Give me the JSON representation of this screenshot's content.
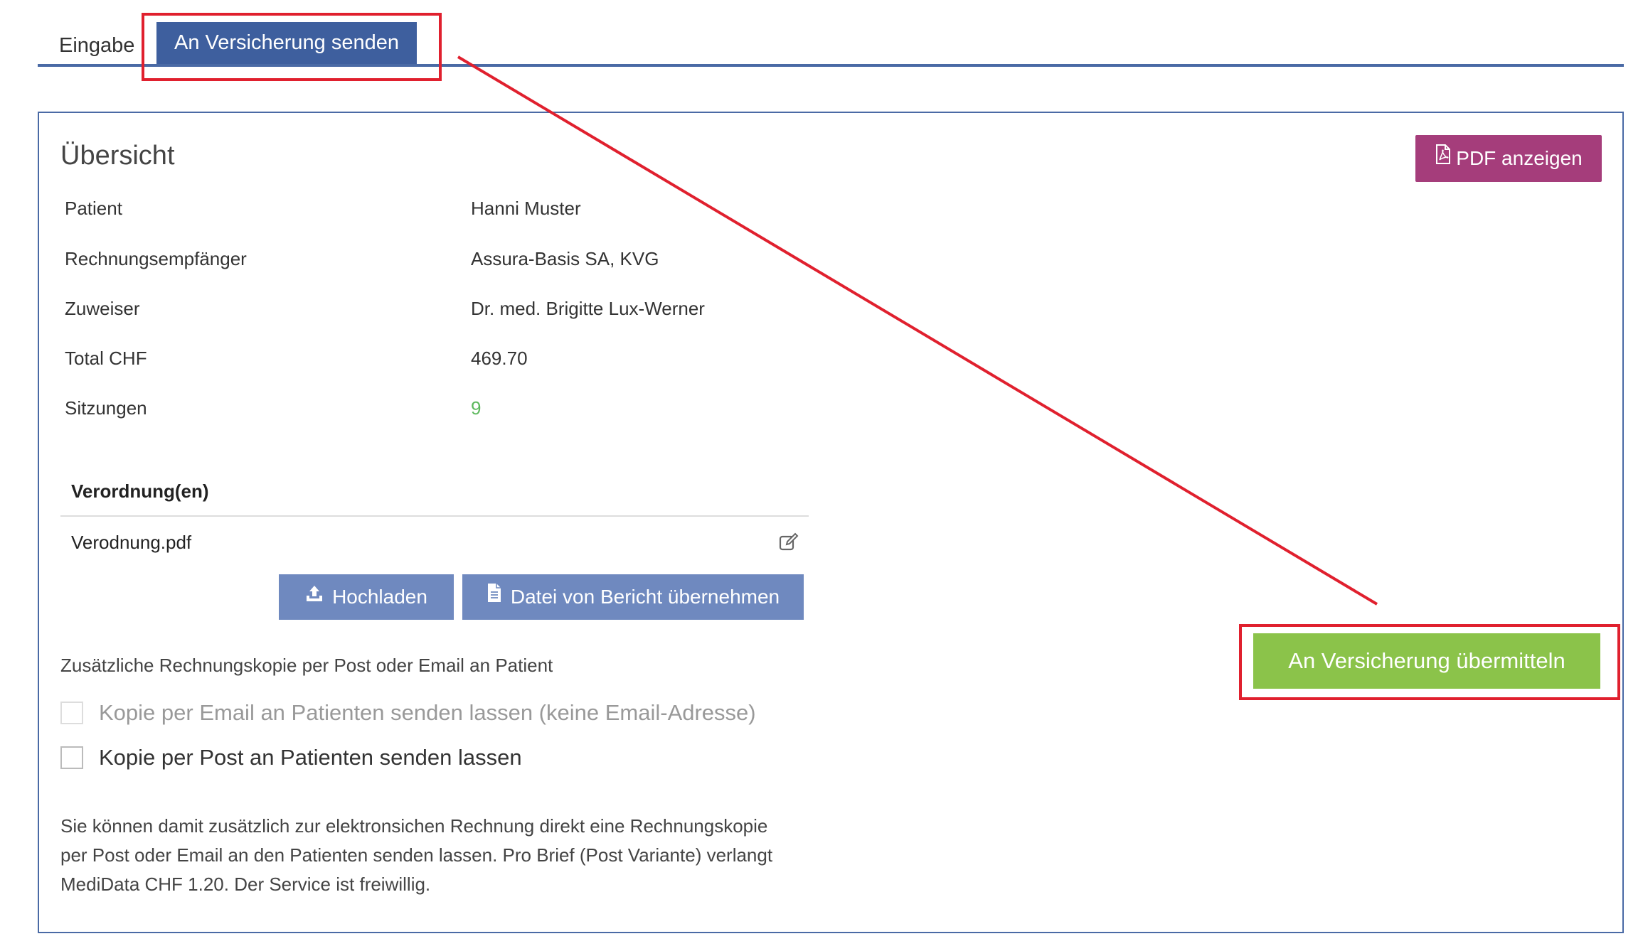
{
  "tabs": {
    "eingabe": "Eingabe",
    "versicherung_senden": "An Versicherung senden"
  },
  "overview": {
    "title": "Übersicht",
    "pdf_button": "PDF anzeigen",
    "rows": [
      {
        "label": "Patient",
        "value": "Hanni Muster"
      },
      {
        "label": "Rechnungsempfänger",
        "value": "Assura-Basis SA, KVG"
      },
      {
        "label": "Zuweiser",
        "value": "Dr. med. Brigitte Lux-Werner"
      },
      {
        "label": "Total CHF",
        "value": "469.70"
      },
      {
        "label": "Sitzungen",
        "value": "9"
      }
    ]
  },
  "verordnungen": {
    "title": "Verordnung(en)",
    "file_name": "Verodnung.pdf",
    "upload_button": "Hochladen",
    "from_report_button": "Datei von Bericht übernehmen"
  },
  "copy": {
    "heading": "Zusätzliche Rechnungskopie per Post oder Email an Patient",
    "email_option": "Kopie per Email an Patienten senden lassen (keine Email-Adresse)",
    "post_option": "Kopie per Post an Patienten senden lassen",
    "description_lines": [
      "Sie können damit zusätzlich zur elektronsichen Rechnung direkt eine Rechnungskopie",
      "per Post oder Email an den Patienten senden lassen. Pro Brief (Post Variante) verlangt",
      "MediData CHF 1.20. Der Service ist freiwillig."
    ]
  },
  "submit_button": "An Versicherung übermitteln",
  "colors": {
    "tab_active": "#3e5f9e",
    "pdf_button": "#a53d7b",
    "blue_buttons": "#6f89bf",
    "submit_button": "#8bc34a",
    "annotation": "#e0202e",
    "sitzungen_value": "#5cb85c"
  }
}
